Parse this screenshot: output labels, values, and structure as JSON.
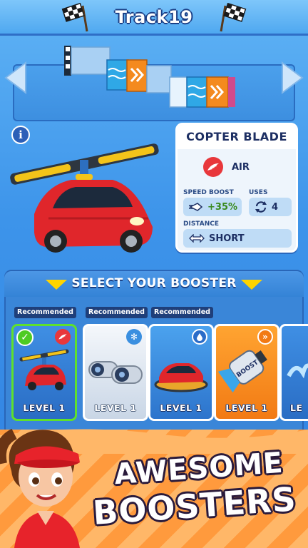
{
  "header": {
    "title": "Track19"
  },
  "booster_detail": {
    "name": "COPTER BLADE",
    "type": "AIR",
    "speed_boost_label": "SPEED BOOST",
    "speed_boost_value": "+35%",
    "uses_label": "USES",
    "uses_value": "4",
    "distance_label": "DISTANCE",
    "distance_value": "SHORT"
  },
  "select": {
    "title": "SELECT YOUR BOOSTER"
  },
  "boosters": [
    {
      "recommended": "Recommended",
      "level": "LEVEL 1",
      "selected": true,
      "badge_icon": "wing-icon"
    },
    {
      "recommended": "Recommended",
      "level": "LEVEL 1",
      "selected": false,
      "badge_icon": "snowflake-icon"
    },
    {
      "recommended": "Recommended",
      "level": "LEVEL 1",
      "selected": false,
      "badge_icon": "water-drop-icon"
    },
    {
      "recommended": "",
      "level": "LEVEL 1",
      "selected": false,
      "badge_icon": "chevrons-icon"
    },
    {
      "recommended": "",
      "level": "LE",
      "selected": false,
      "badge_icon": ""
    }
  ],
  "promo": {
    "line1": "AWESOME",
    "line2": "BOOSTERS"
  },
  "colors": {
    "sky_blue": "#3d94ea",
    "accent_yellow": "#ffd400",
    "selected_green": "#5fe02c",
    "air_red": "#e8373b",
    "promo_orange": "#ff9a3d"
  }
}
